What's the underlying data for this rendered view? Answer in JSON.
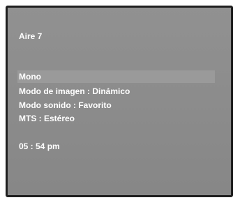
{
  "channel": "Aire 7",
  "menu": {
    "items": [
      "Mono",
      "Modo de imagen : Dinámico",
      "Modo sonido : Favorito",
      "MTS : Estéreo"
    ]
  },
  "clock": "05 : 54 pm",
  "colors": {
    "frame": "#1f1f1f",
    "background": "#8b8b8b",
    "highlight": "#9a9a9a",
    "text": "#ffffff"
  }
}
